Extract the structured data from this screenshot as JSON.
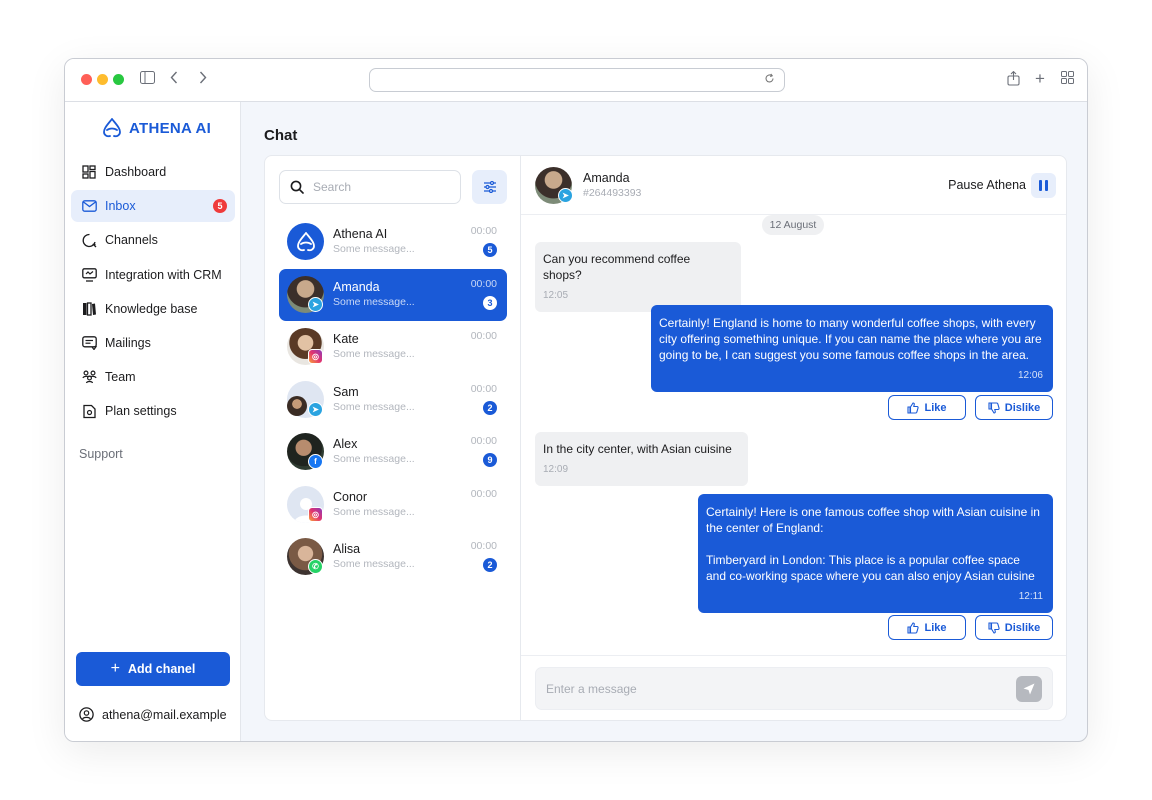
{
  "browser": {
    "url": ""
  },
  "app": {
    "logo_text": "ATHENA AI",
    "page_title": "Chat"
  },
  "sidebar": {
    "items": [
      {
        "label": "Dashboard",
        "icon": "dashboard-icon"
      },
      {
        "label": "Inbox",
        "icon": "mail-icon",
        "badge": "5",
        "active": true
      },
      {
        "label": "Channels",
        "icon": "channels-icon"
      },
      {
        "label": "Integration with CRM",
        "icon": "crm-icon"
      },
      {
        "label": "Knowledge base",
        "icon": "books-icon"
      },
      {
        "label": "Mailings",
        "icon": "mailings-icon"
      },
      {
        "label": "Team",
        "icon": "team-icon"
      },
      {
        "label": "Plan settings",
        "icon": "plan-icon"
      }
    ],
    "support_label": "Support",
    "add_button": "Add chanel",
    "account_email": "athena@mail.example"
  },
  "chat_list": {
    "search_placeholder": "Search",
    "contacts": [
      {
        "name": "Athena AI",
        "message": "Some message...",
        "time": "00:00",
        "unread": "5",
        "channel": "athena"
      },
      {
        "name": "Amanda",
        "message": "Some message...",
        "time": "00:00",
        "unread": "3",
        "channel": "telegram",
        "active": true
      },
      {
        "name": "Kate",
        "message": "Some message...",
        "time": "00:00",
        "unread": "",
        "channel": "instagram"
      },
      {
        "name": "Sam",
        "message": "Some message...",
        "time": "00:00",
        "unread": "2",
        "channel": "telegram"
      },
      {
        "name": "Alex",
        "message": "Some message...",
        "time": "00:00",
        "unread": "9",
        "channel": "facebook"
      },
      {
        "name": "Conor",
        "message": "Some message...",
        "time": "00:00",
        "unread": "",
        "channel": "instagram"
      },
      {
        "name": "Alisa",
        "message": "Some message...",
        "time": "00:00",
        "unread": "2",
        "channel": "whatsapp"
      }
    ]
  },
  "conversation": {
    "name": "Amanda",
    "id": "#264493393",
    "pause_label": "Pause Athena",
    "date": "12 August",
    "messages": [
      {
        "dir": "in",
        "text": "Can you recommend coffee shops?",
        "time": "12:05"
      },
      {
        "dir": "out",
        "text": "Certainly! England is home to many wonderful coffee shops, with every city offering something unique. If you can name the place where you are going to be, I can suggest you some famous coffee shops in the area.",
        "time": "12:06"
      },
      {
        "dir": "in",
        "text": "In the city center, with Asian cuisine",
        "time": "12:09"
      },
      {
        "dir": "out",
        "text_1": "Certainly! Here is one famous coffee shop with Asian cuisine in the center of England:",
        "text_2": "Timberyard in London: This place is a popular coffee space and co-working space where you can also enjoy Asian cuisine",
        "time": "12:11"
      }
    ],
    "like_label": "Like",
    "dislike_label": "Dislike",
    "input_placeholder": "Enter a message"
  },
  "colors": {
    "accent": "#1a5ad7",
    "badge_red": "#ef3b3b",
    "bubble_in": "#eff0f2"
  }
}
